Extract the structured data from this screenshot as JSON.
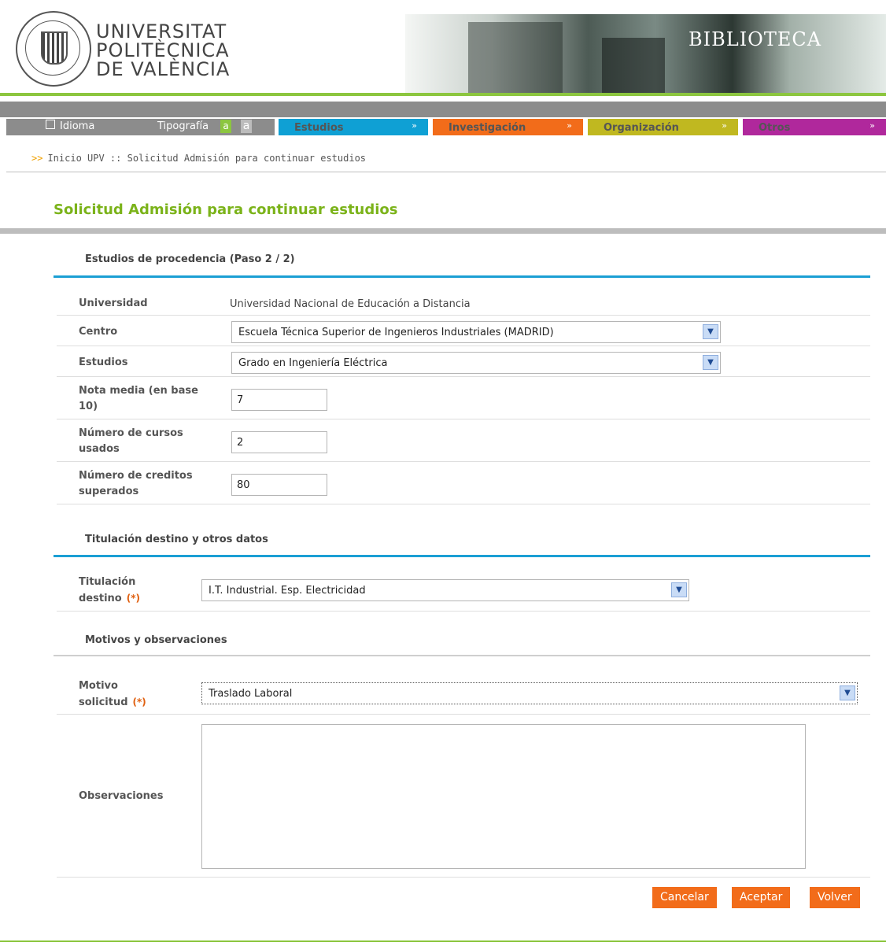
{
  "header": {
    "logo_lines": [
      "UNIVERSITAT",
      "POLITÈCNICA",
      "DE VALÈNCIA"
    ],
    "banner_sign": "BIBLIOTECA"
  },
  "nav": {
    "idioma": "Idioma",
    "tipografia": "Tipografía",
    "font_small": "a",
    "font_large": "a",
    "items": [
      {
        "label": "Estudios",
        "color": "#0fa0d4"
      },
      {
        "label": "Investigación",
        "color": "#f26c1a"
      },
      {
        "label": "Organización",
        "color": "#c0b820"
      },
      {
        "label": "Otros",
        "color": "#b0289c"
      }
    ],
    "chevron": "»"
  },
  "breadcrumb": {
    "arrow": ">>",
    "text": "Inicio UPV :: Solicitud Admisión para continuar estudios"
  },
  "page_title": "Solicitud Admisión para continuar estudios",
  "sections": {
    "procedencia": "Estudios de procedencia (Paso 2 / 2)",
    "destino": "Titulación destino y otros datos",
    "motivos": "Motivos y observaciones"
  },
  "form": {
    "universidad_label": "Universidad",
    "universidad_value": "Universidad Nacional de Educación a Distancia",
    "centro_label": "Centro",
    "centro_value": "Escuela Técnica Superior de Ingenieros Industriales (MADRID)",
    "estudios_label": "Estudios",
    "estudios_value": "Grado en Ingeniería Eléctrica",
    "nota_label_1": "Nota media (en base",
    "nota_label_2": "10)",
    "nota_value": "7",
    "cursos_label_1": "Número de cursos",
    "cursos_label_2": "usados",
    "cursos_value": "2",
    "creditos_label_1": "Número de creditos",
    "creditos_label_2": "superados",
    "creditos_value": "80",
    "titulacion_label_1": "Titulación",
    "titulacion_label_2": "destino",
    "titulacion_value": "I.T. Industrial. Esp. Electricidad",
    "motivo_label_1": "Motivo",
    "motivo_label_2": "solicitud",
    "motivo_value": "Traslado Laboral",
    "observaciones_label": "Observaciones",
    "observaciones_value": "",
    "required_mark": "(*)",
    "select_arrow": "▼"
  },
  "buttons": {
    "cancel": "Cancelar",
    "accept": "Aceptar",
    "back": "Volver"
  }
}
